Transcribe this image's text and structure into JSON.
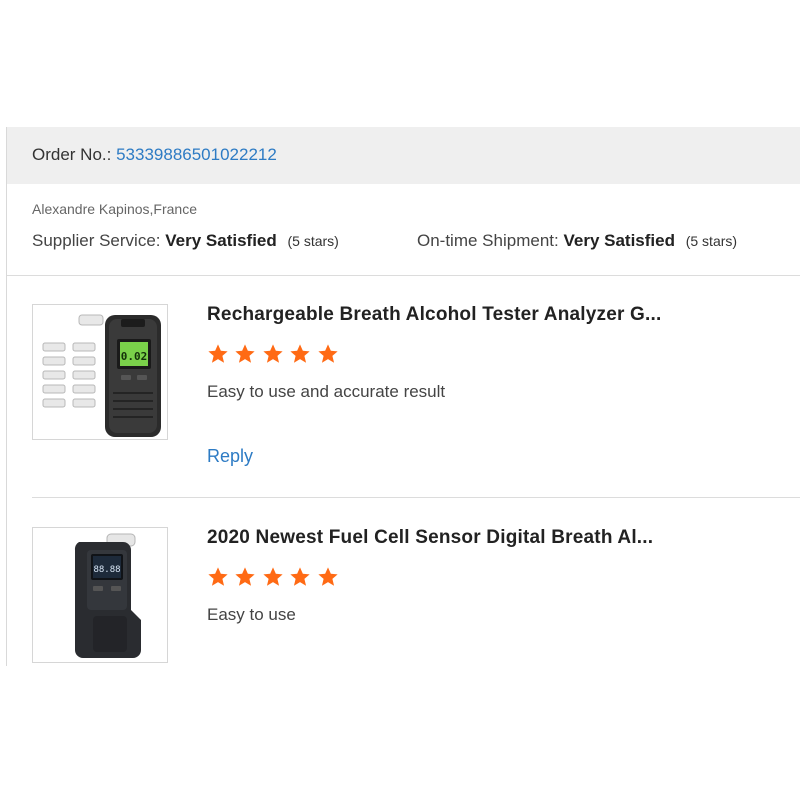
{
  "order": {
    "label": "Order No.:",
    "number": "53339886501022212"
  },
  "buyer": {
    "name_location": "Alexandre Kapinos,France"
  },
  "ratings": {
    "supplier_label": "Supplier Service:",
    "supplier_value": "Very Satisfied",
    "supplier_stars": "(5 stars)",
    "shipment_label": "On-time Shipment:",
    "shipment_value": "Very Satisfied",
    "shipment_stars": "(5 stars)"
  },
  "items": [
    {
      "title": "Rechargeable Breath Alcohol Tester Analyzer G...",
      "stars": 5,
      "comment": "Easy to use and accurate result",
      "reply_label": "Reply",
      "display_text": "0.02"
    },
    {
      "title": "2020 Newest Fuel Cell Sensor Digital Breath Al...",
      "stars": 5,
      "comment": "Easy to use",
      "display_text": "88.88"
    }
  ],
  "colors": {
    "link": "#2d7bc4",
    "star": "#ff6a14",
    "header_bg": "#efefef"
  }
}
